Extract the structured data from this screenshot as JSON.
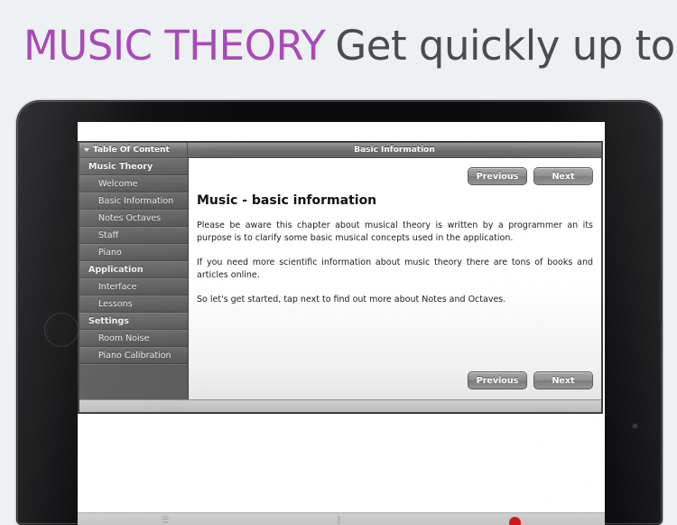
{
  "banner": {
    "strong_text": "MUSIC THEORY",
    "rest_text": "Get quickly up to speed!",
    "strong_color": "#a84bb6",
    "rest_color": "#4c4c4e"
  },
  "help_window": {
    "toc_header_label": "Table Of Content",
    "toc_disclosure_icon": "triangle-down-icon",
    "page_title": "Basic Information",
    "sidebar": [
      {
        "type": "group",
        "label": "Music Theory"
      },
      {
        "type": "item",
        "label": "Welcome"
      },
      {
        "type": "item",
        "label": "Basic Information"
      },
      {
        "type": "item",
        "label": "Notes Octaves"
      },
      {
        "type": "item",
        "label": "Staff"
      },
      {
        "type": "item",
        "label": "Piano"
      },
      {
        "type": "group",
        "label": "Application"
      },
      {
        "type": "item",
        "label": "Interface"
      },
      {
        "type": "item",
        "label": "Lessons"
      },
      {
        "type": "group",
        "label": "Settings"
      },
      {
        "type": "item",
        "label": "Room Noise"
      },
      {
        "type": "item",
        "label": "Piano Calibration"
      }
    ],
    "content": {
      "heading": "Music - basic information",
      "paragraphs": [
        "Please be aware this chapter about musical theory is written by a programmer an its purpose is to clarify some basic musical concepts used in the application.",
        "If you need more scientific information about music theory there are tons of books and articles online.",
        "So let's get started, tap next to find out more about Notes and Octaves."
      ]
    },
    "nav": {
      "previous_label": "Previous",
      "next_label": "Next"
    }
  },
  "app_toolbar": {
    "items": [
      {
        "icon": "list-icon",
        "glyph": "☰"
      },
      {
        "icon": "pause-icon",
        "glyph": "‖"
      },
      {
        "icon": "record-icon",
        "glyph": ""
      }
    ]
  }
}
